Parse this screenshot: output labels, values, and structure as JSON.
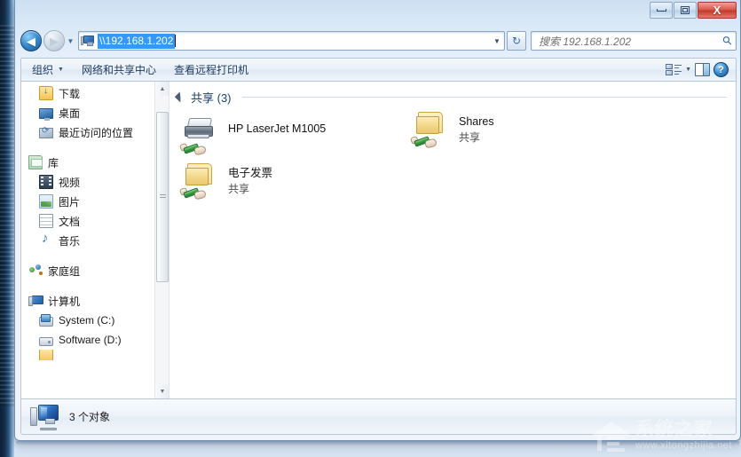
{
  "window": {
    "controls": {
      "minimize": "–",
      "maximize": "□",
      "close": "X"
    }
  },
  "address": {
    "back_glyph": "◀",
    "forward_glyph": "▶",
    "history_caret": "▼",
    "path_value": "\\\\192.168.1.202",
    "dropdown_caret": "▼",
    "refresh_glyph": "↻",
    "computer_icon": "computer-icon"
  },
  "search": {
    "placeholder": "搜索 192.168.1.202",
    "icon": "search-icon"
  },
  "toolbar": {
    "organize_label": "组织",
    "organize_caret": "▼",
    "network_sharing_label": "网络和共享中心",
    "remote_printers_label": "查看远程打印机",
    "view_caret": "▼",
    "help_glyph": "?"
  },
  "sidebar": {
    "items": [
      {
        "label": "下载",
        "icon": "downloads-folder-icon",
        "indent": "child"
      },
      {
        "label": "桌面",
        "icon": "desktop-icon",
        "indent": "child"
      },
      {
        "label": "最近访问的位置",
        "icon": "recent-places-icon",
        "indent": "child"
      },
      {
        "label": "库",
        "icon": "libraries-icon",
        "indent": "root"
      },
      {
        "label": "视频",
        "icon": "videos-icon",
        "indent": "child"
      },
      {
        "label": "图片",
        "icon": "pictures-icon",
        "indent": "child"
      },
      {
        "label": "文档",
        "icon": "documents-icon",
        "indent": "child"
      },
      {
        "label": "音乐",
        "icon": "music-icon",
        "indent": "child"
      },
      {
        "label": "家庭组",
        "icon": "homegroup-icon",
        "indent": "root"
      },
      {
        "label": "计算机",
        "icon": "computer-icon",
        "indent": "root"
      },
      {
        "label": "System (C:)",
        "icon": "system-drive-icon",
        "indent": "child"
      },
      {
        "label": "Software (D:)",
        "icon": "drive-icon",
        "indent": "child"
      }
    ],
    "scroll_up_glyph": "▲",
    "scroll_down_glyph": "▼"
  },
  "content": {
    "group_title": "共享 (3)",
    "items": [
      {
        "name": "HP LaserJet M1005",
        "sub": "",
        "icon": "shared-printer-icon"
      },
      {
        "name": "Shares",
        "sub": "共享",
        "icon": "shared-folder-icon"
      },
      {
        "name": "电子发票",
        "sub": "共享",
        "icon": "shared-folder-icon"
      }
    ]
  },
  "status": {
    "text": "3 个对象",
    "icon": "computer-icon"
  },
  "watermark": {
    "title": "系统之家",
    "url": "www.xitongzhijia.net"
  },
  "colors": {
    "accent": "#3399ff",
    "close_red": "#c03a2b",
    "folder_yellow": "#f2d484",
    "share_green": "#2f9b3c",
    "group_title": "#1b3f6b"
  }
}
